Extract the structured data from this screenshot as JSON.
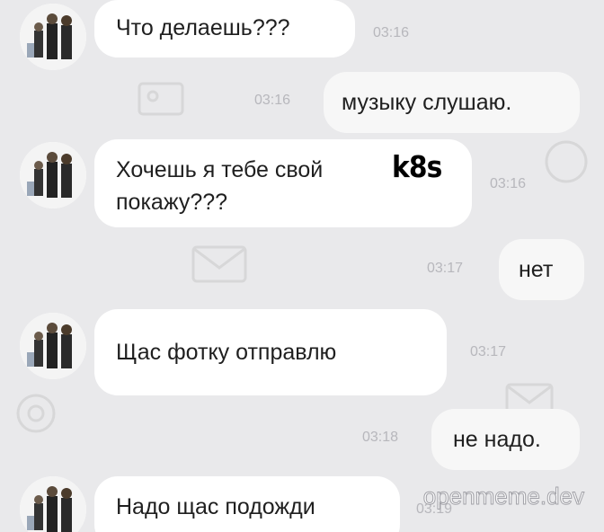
{
  "chat": {
    "messages": [
      {
        "direction": "incoming",
        "text": "Что делаешь???",
        "time": "03:16"
      },
      {
        "direction": "outgoing",
        "text": "музыку слушаю.",
        "time": "03:16"
      },
      {
        "direction": "incoming",
        "text_line1": "Хочешь я тебе свой",
        "text_line2": "покажу???",
        "overlay": "k8s",
        "time": "03:16"
      },
      {
        "direction": "outgoing",
        "text": "нет",
        "time": "03:17"
      },
      {
        "direction": "incoming",
        "text": "Щас фотку отправлю",
        "time": "03:17"
      },
      {
        "direction": "outgoing",
        "text": "не надо.",
        "time": "03:18"
      },
      {
        "direction": "incoming",
        "text": "Надо щас подожди",
        "time": "03:19"
      }
    ]
  },
  "watermark": "openmeme.dev",
  "colors": {
    "background": "#e9e9eb",
    "incoming_bubble": "#ffffff",
    "outgoing_bubble": "#f7f7f7",
    "time_text": "#b7b7bc"
  }
}
